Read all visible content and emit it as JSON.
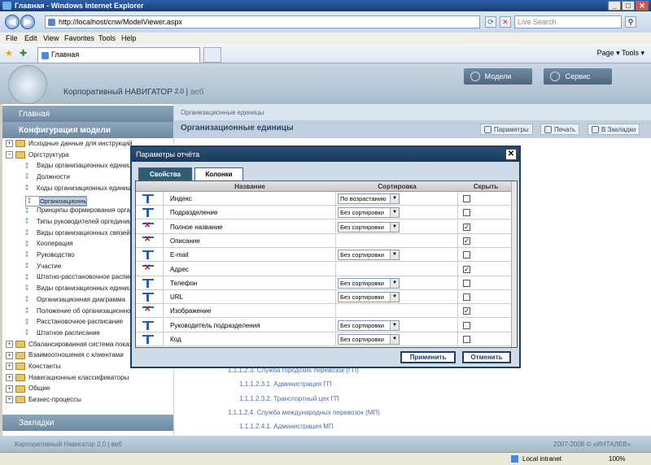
{
  "window": {
    "title": "Главная - Windows Internet Explorer"
  },
  "browser": {
    "url": "http://localhost/cnw/ModelViewer.aspx",
    "search_placeholder": "Live Search",
    "menu": [
      "File",
      "Edit",
      "View",
      "Favorites",
      "Tools",
      "Help"
    ],
    "tab_title": "Главная",
    "tools_right": "Page ▾   Tools ▾"
  },
  "app": {
    "name": "Корпоративный НАВИГАТОР",
    "version": "2.0",
    "suffix": "веб",
    "buttons": {
      "models": "Модели",
      "service": "Сервис"
    }
  },
  "sidebar": {
    "home": "Главная",
    "config": "Конфигурация модели",
    "bookmarks": "Закладки",
    "tree": [
      {
        "label": "Исходные данные для инструкций",
        "type": "folder",
        "depth": 0,
        "exp": "+"
      },
      {
        "label": "Оргструктура",
        "type": "folder",
        "depth": 0,
        "exp": "−"
      },
      {
        "label": "Виды организационных единиц",
        "type": "leaf",
        "depth": 1
      },
      {
        "label": "Должности",
        "type": "leaf",
        "depth": 1
      },
      {
        "label": "Коды организационных единиц",
        "type": "leaf",
        "depth": 1
      },
      {
        "label": "Организационные единицы",
        "type": "leaf",
        "depth": 1,
        "selected": true
      },
      {
        "label": "Принципы формирования организ",
        "type": "leaf",
        "depth": 1
      },
      {
        "label": "Типы руководителей оргединиц",
        "type": "leaf",
        "depth": 1
      },
      {
        "label": "Виды организационных связей",
        "type": "leaf",
        "depth": 1
      },
      {
        "label": "Кооперация",
        "type": "leaf",
        "depth": 1
      },
      {
        "label": "Руководство",
        "type": "leaf",
        "depth": 1
      },
      {
        "label": "Участие",
        "type": "leaf",
        "depth": 1
      },
      {
        "label": "Штатно-расстановочное распис",
        "type": "leaf",
        "depth": 1
      },
      {
        "label": "Виды организационных единиц",
        "type": "leaf",
        "depth": 1
      },
      {
        "label": "Организационная диаграмма",
        "type": "leaf",
        "depth": 1
      },
      {
        "label": "Положение об организационной",
        "type": "leaf",
        "depth": 1
      },
      {
        "label": "Расстановочное расписание",
        "type": "leaf",
        "depth": 1
      },
      {
        "label": "Штатное расписание",
        "type": "leaf",
        "depth": 1
      },
      {
        "label": "Сбалансированная система показ",
        "type": "folder",
        "depth": 0,
        "exp": "+"
      },
      {
        "label": "Взаимоотношения с клиентами",
        "type": "folder",
        "depth": 0,
        "exp": "+"
      },
      {
        "label": "Константы",
        "type": "folder",
        "depth": 0,
        "exp": "+"
      },
      {
        "label": "Навигационные классификаторы",
        "type": "folder",
        "depth": 0,
        "exp": "+"
      },
      {
        "label": "Общие",
        "type": "folder",
        "depth": 0,
        "exp": "+"
      },
      {
        "label": "Бизнес-процессы",
        "type": "folder",
        "depth": 0,
        "exp": "+"
      }
    ]
  },
  "main": {
    "breadcrumb": "Организационные единицы",
    "title": "Организационные единицы",
    "actions": {
      "params": "Параметры",
      "print": "Печать",
      "bookmark": "В Закладки"
    },
    "org_lines": [
      "1.1.1.2.3. Служба городских перевозок (ГП)",
      "1.1.1.2.3.1. Администрация ГП",
      "1.1.1.2.3.2. Транспортный цех ГП",
      "1.1.1.2.4. Служба международных перевозок (МП)",
      "1.1.1.2.4.1. Администрация МП"
    ]
  },
  "footer": {
    "left": "Корпоративный Навигатор 2.0 | веб",
    "right": "2007-2008 © «ИНТАЛЕВ»"
  },
  "status": {
    "zone": "Local intranet",
    "zoom": "100%"
  },
  "dialog": {
    "title": "Параметры отчёта",
    "tabs": {
      "props": "Свойства",
      "cols": "Колонки"
    },
    "headers": {
      "name": "Название",
      "sort": "Сортировка",
      "hide": "Скрыть"
    },
    "rows": [
      {
        "name": "Индекс",
        "sort": "По возрастанию",
        "hidden": false,
        "visible": true
      },
      {
        "name": "Подразделение",
        "sort": "Без сортировки",
        "hidden": false,
        "visible": true
      },
      {
        "name": "Полное название",
        "sort": "Без сортировки",
        "hidden": true,
        "visible": false
      },
      {
        "name": "Описание",
        "sort": "",
        "hidden": true,
        "visible": false
      },
      {
        "name": "E-mail",
        "sort": "Без сортировки",
        "hidden": false,
        "visible": true
      },
      {
        "name": "Адрес",
        "sort": "",
        "hidden": true,
        "visible": false
      },
      {
        "name": "Телефон",
        "sort": "Без сортировки",
        "hidden": false,
        "visible": true
      },
      {
        "name": "URL",
        "sort": "Без сортировки",
        "hidden": false,
        "visible": true
      },
      {
        "name": "Изображение",
        "sort": "",
        "hidden": true,
        "visible": false
      },
      {
        "name": "Руководитель подразделения",
        "sort": "Без сортировки",
        "hidden": false,
        "visible": true
      },
      {
        "name": "Код",
        "sort": "Без сортировки",
        "hidden": false,
        "visible": true
      }
    ],
    "apply": "Применить",
    "cancel": "Отменить"
  }
}
